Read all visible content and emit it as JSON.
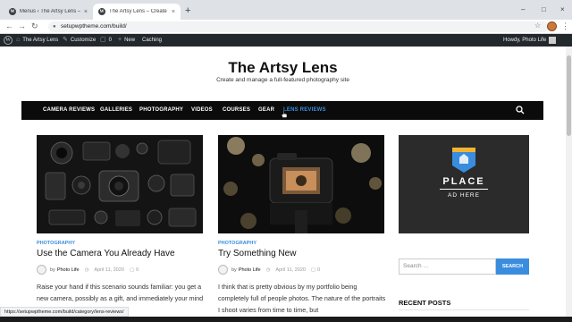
{
  "browser": {
    "tabs": [
      {
        "title": "Menus ‹ The Artsy Lens — WordPress",
        "active": false
      },
      {
        "title": "The Artsy Lens – Create and manage",
        "active": true
      }
    ],
    "new_tab": "+",
    "close_glyph": "×",
    "window_controls": [
      "–",
      "□",
      "×"
    ],
    "url": "setupwptheme.com/build/",
    "status_url": "https://setupwptheme.com/build/category/lens-reviews/"
  },
  "admin_bar": {
    "site_name": "The Artsy Lens",
    "customize": "Customize",
    "comments": "0",
    "new": "New",
    "caching": "Caching",
    "howdy": "Howdy, Photo Life"
  },
  "site": {
    "title": "The Artsy Lens",
    "tagline": "Create and manage a full-featured photography site"
  },
  "nav": {
    "items": [
      "CAMERA REVIEWS",
      "GALLERIES",
      "PHOTOGRAPHY",
      "VIDEOS",
      "COURSES",
      "GEAR",
      "LENS REVIEWS"
    ],
    "highlighted": "LENS REVIEWS"
  },
  "posts": [
    {
      "category": "PHOTOGRAPHY",
      "title": "Use the Camera You Already Have",
      "by": "by",
      "author": "Photo Life",
      "date": "April 11, 2020",
      "comments": "0",
      "excerpt": "Raise your hand if this scenario sounds familiar: you get a new camera, possibly as a gift, and immediately your mind leaps with excitement at"
    },
    {
      "category": "PHOTOGRAPHY",
      "title": "Try Something New",
      "by": "by",
      "author": "Photo Life",
      "date": "April 11, 2020",
      "comments": "0",
      "excerpt": "I think that is pretty obvious by my portfolio being completely full of people photos. The nature of the portraits I shoot varies from time to time, but"
    }
  ],
  "sidebar": {
    "ad_place": "PLACE",
    "ad_here": "AD HERE",
    "search_placeholder": "Search …",
    "search_button": "SEARCH",
    "recent_posts": "RECENT POSTS"
  },
  "colors": {
    "accent": "#3a8dde",
    "nav_bg": "#0b0b0b",
    "admin_bar_bg": "#23282d"
  }
}
